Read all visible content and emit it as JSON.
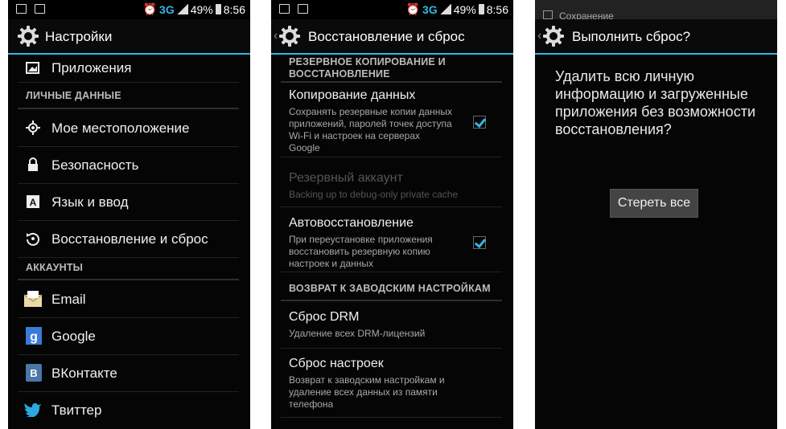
{
  "status_bar": {
    "network": "3G",
    "battery": "49%",
    "time": "8:56"
  },
  "screen1": {
    "title": "Настройки",
    "items": [
      {
        "label": "Приложения",
        "icon": "apps-icon"
      },
      {
        "header": "ЛИЧНЫЕ ДАННЫЕ"
      },
      {
        "label": "Мое местоположение",
        "icon": "location-icon"
      },
      {
        "label": "Безопасность",
        "icon": "lock-icon"
      },
      {
        "label": "Язык и ввод",
        "icon": "keyboard-icon"
      },
      {
        "label": "Восстановление и сброс",
        "icon": "restore-icon"
      },
      {
        "header": "АККАУНТЫ"
      },
      {
        "label": "Email",
        "icon": "email-icon"
      },
      {
        "label": "Google",
        "icon": "google-icon"
      },
      {
        "label": "ВКонтакте",
        "icon": "vk-icon"
      },
      {
        "label": "Твиттер",
        "icon": "twitter-icon"
      }
    ]
  },
  "screen2": {
    "title": "Восстановление и сброс",
    "header1_line1": "РЕЗЕРВНОЕ КОПИРОВАНИЕ И",
    "header1_line2": "ВОССТАНОВЛЕНИЕ",
    "backup_title": "Копирование данных",
    "backup_summary": "Сохранять резервные копии данных приложений, паролей точек доступа Wi-Fi и настроек на серверах Google",
    "backup_checked": true,
    "account_title": "Резервный аккаунт",
    "account_summary": "Backing up to debug-only private cache",
    "autorestore_title": "Автовосстановление",
    "autorestore_summary": "При переустановке приложения восстановить резервную копию настроек и данных",
    "autorestore_checked": true,
    "header2": "ВОЗВРАТ К ЗАВОДСКИМ НАСТРОЙКАМ",
    "drm_title": "Сброс DRM",
    "drm_summary": "Удаление всех DRM-лицензий",
    "factory_title": "Сброс настроек",
    "factory_summary": "Возврат к заводским настройкам и удаление всех данных из памяти телефона"
  },
  "screen3": {
    "peek_text": "Сохранение",
    "title": "Выполнить сброс?",
    "message": "Удалить всю личную информацию и загруженные приложения без возможности восстановления?",
    "button": "Стереть все"
  },
  "colors": {
    "accent": "#33b5e5",
    "background": "#050505"
  }
}
